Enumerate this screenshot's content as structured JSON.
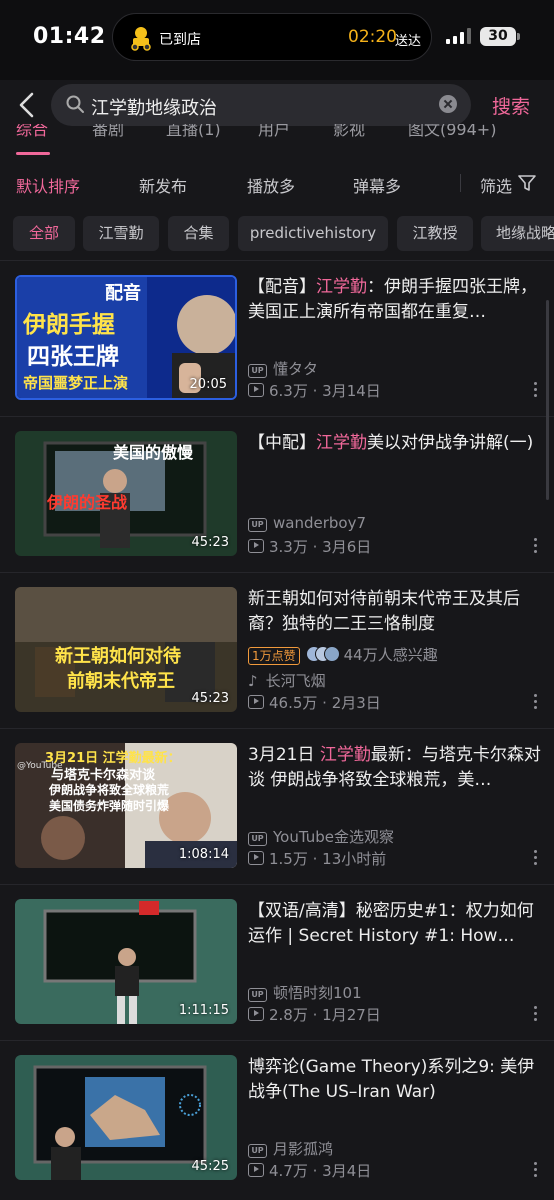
{
  "status_bar": {
    "time": "01:42",
    "island_left": "已到店",
    "island_time": "02:20",
    "island_right": "送达",
    "battery": "30"
  },
  "search": {
    "query": "江学勤地缘政治",
    "button": "搜索"
  },
  "tabs": [
    "综合",
    "番剧",
    "直播(1)",
    "用户",
    "影视",
    "图文(994+)"
  ],
  "sort": {
    "options": [
      "默认排序",
      "新发布",
      "播放多",
      "弹幕多"
    ],
    "filter": "筛选"
  },
  "chips": [
    "全部",
    "江雪勤",
    "合集",
    "predictivehistory",
    "江教授",
    "地缘战略"
  ],
  "results": [
    {
      "title_pre": "【配音】",
      "title_hl": "江学勤",
      "title_post": "：伊朗手握四张王牌，美国正上演所有帝国都在重复…",
      "thumb_texts": [
        "配音",
        "伊朗手握",
        "四张王牌",
        "帝国噩梦正上演"
      ],
      "duration": "20:05",
      "uploader": "懂タタ",
      "views": "6.3万",
      "date": "3月14日"
    },
    {
      "title_pre": "【中配】",
      "title_hl": "江学勤",
      "title_post": "美以对伊战争讲解(一)",
      "thumb_texts": [
        "美国的傲慢",
        "伊朗的圣战"
      ],
      "duration": "45:23",
      "uploader": "wanderboy7",
      "views": "3.3万",
      "date": "3月6日"
    },
    {
      "title_pre": "新王朝如何对待前朝末代帝王及其后裔？独特的二王三恪制度",
      "title_hl": "",
      "title_post": "",
      "thumb_texts": [
        "新王朝如何对待",
        "前朝末代帝王"
      ],
      "duration": "45:23",
      "popular_badge": "1万点赞",
      "interest": "44万人感兴趣",
      "uploader": "长河飞烟",
      "views": "46.5万",
      "date": "2月3日"
    },
    {
      "title_pre": "3月21日 ",
      "title_hl": "江学勤",
      "title_post": "最新：与塔克卡尔森对谈 伊朗战争将致全球粮荒，美…",
      "thumb_texts": [
        "3月21日 江学勤最新：",
        "与塔克卡尔森对谈",
        "伊朗战争将致全球粮荒",
        "美国债务炸弹随时引爆",
        "@YouTube"
      ],
      "duration": "1:08:14",
      "uploader": "YouTube金选观察",
      "views": "1.5万",
      "date": "13小时前"
    },
    {
      "title_pre": "【双语/高清】秘密历史#1：权力如何运作 | Secret History #1: How…",
      "title_hl": "",
      "title_post": "",
      "thumb_texts": [],
      "duration": "1:11:15",
      "uploader": "顿悟时刻101",
      "views": "2.8万",
      "date": "1月27日"
    },
    {
      "title_pre": "博弈论(Game Theory)系列之9: 美伊战争(The US–Iran War)",
      "title_hl": "",
      "title_post": "",
      "thumb_texts": [],
      "duration": "45:25",
      "uploader": "月影孤鸿",
      "views": "4.7万",
      "date": "3月4日"
    }
  ],
  "colors": {
    "accent": "#f0689a",
    "background": "#17171a",
    "meta": "#8f8f96",
    "popular": "#f19a3c"
  }
}
